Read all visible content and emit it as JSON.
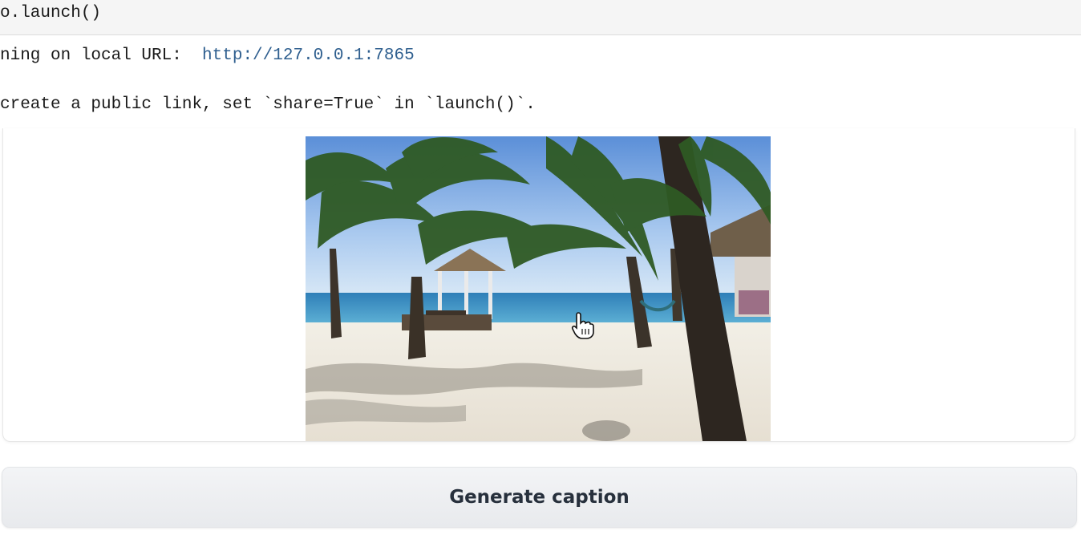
{
  "code_cell": {
    "line": "o.launch()"
  },
  "output": {
    "running_prefix": "ning on local URL:  ",
    "local_url": "http://127.0.0.1:7865",
    "share_hint": "create a public link, set `share=True` in `launch()`."
  },
  "image_panel": {
    "image_subject": "tropical beach with palm trees and a thatched gazebo"
  },
  "actions": {
    "generate_label": "Generate caption"
  },
  "colors": {
    "url": "#2f5f8f",
    "button_bg": "#eceef1",
    "button_text": "#27303c"
  }
}
